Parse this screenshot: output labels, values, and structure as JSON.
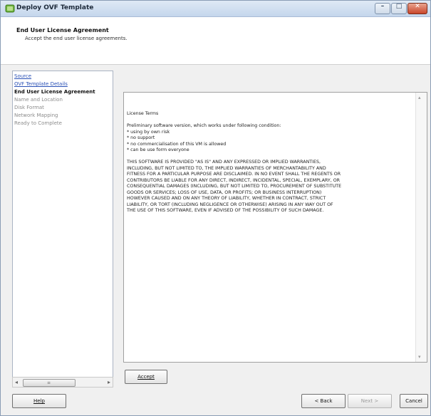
{
  "window": {
    "title": "Deploy OVF Template",
    "controls": [
      "minimize-icon",
      "maximize-icon",
      "close-icon"
    ]
  },
  "header": {
    "title": "End User License Agreement",
    "subtitle": "Accept the end user license agreements."
  },
  "sidebar": {
    "items": [
      {
        "label": "Source",
        "state": "link"
      },
      {
        "label": "OVF Template Details",
        "state": "link"
      },
      {
        "label": "End User License Agreement",
        "state": "active"
      },
      {
        "label": "Name and Location",
        "state": "disabled"
      },
      {
        "label": "Disk Format",
        "state": "disabled"
      },
      {
        "label": "Network Mapping",
        "state": "disabled"
      },
      {
        "label": "Ready to Complete",
        "state": "disabled"
      }
    ]
  },
  "eula": {
    "lines": [
      "License Terms",
      "",
      "Preliminary software version, which works under following condition:",
      "* using by own risk",
      "* no support",
      "* no commercialisation of this VM is allowed",
      "* can be use form everyone",
      "",
      "THIS SOFTWARE IS PROVIDED \"AS IS\" AND ANY EXPRESSED OR IMPLIED WARRANTIES,",
      "INCLUDING, BUT NOT LIMITED TO, THE IMPLIED WARRANTIES OF MERCHANTABILITY AND",
      "FITNESS FOR A PARTICULAR PURPOSE ARE DISCLAIMED. IN NO EVENT SHALL THE REGENTS OR",
      "CONTRIBUTORS BE LIABLE FOR ANY DIRECT, INDIRECT, INCIDENTAL, SPECIAL, EXEMPLARY, OR",
      "CONSEQUENTIAL DAMAGES (INCLUDING, BUT NOT LIMITED TO, PROCUREMENT OF SUBSTITUTE",
      "GOODS OR SERVICES; LOSS OF USE, DATA, OR PROFITS; OR BUSINESS INTERRUPTION)",
      "HOWEVER CAUSED AND ON ANY THEORY OF LIABILITY, WHETHER IN CONTRACT, STRICT",
      "LIABILITY, OR TORT (INCLUDING NEGLIGENCE OR OTHERWISE) ARISING IN ANY WAY OUT OF",
      "THE USE OF THIS SOFTWARE, EVEN IF ADVISED OF THE POSSIBILITY OF SUCH DAMAGE."
    ]
  },
  "buttons": {
    "accept": "Accept",
    "help": "Help",
    "back": "< Back",
    "next": "Next >",
    "cancel": "Cancel"
  },
  "colors": {
    "link": "#2a51b6",
    "titlebar": "#c4d6ec",
    "close": "#c9462b"
  }
}
